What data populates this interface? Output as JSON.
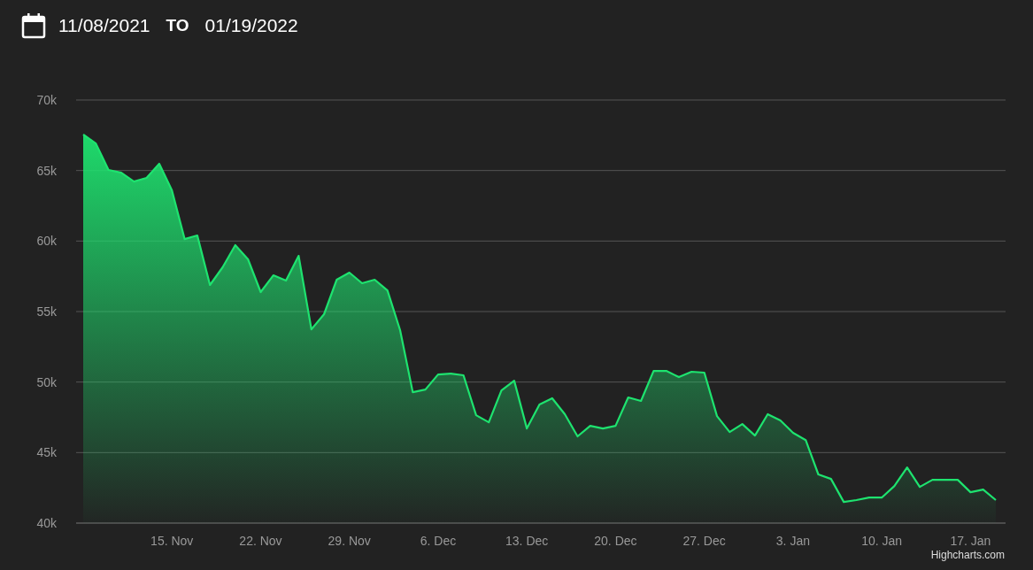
{
  "date_range": {
    "start": "11/08/2021",
    "separator": "TO",
    "end": "01/19/2022"
  },
  "chart_data": {
    "type": "area",
    "grid": true,
    "ylim": [
      40000,
      70000
    ],
    "categories": [
      null,
      null,
      null,
      null,
      null,
      null,
      null,
      "15. Nov",
      null,
      null,
      null,
      null,
      null,
      null,
      "22. Nov",
      null,
      null,
      null,
      null,
      null,
      null,
      "29. Nov",
      null,
      null,
      null,
      null,
      null,
      null,
      "6. Dec",
      null,
      null,
      null,
      null,
      null,
      null,
      "13. Dec",
      null,
      null,
      null,
      null,
      null,
      null,
      "20. Dec",
      null,
      null,
      null,
      null,
      null,
      null,
      "27. Dec",
      null,
      null,
      null,
      null,
      null,
      null,
      "3. Jan",
      null,
      null,
      null,
      null,
      null,
      null,
      "10. Jan",
      null,
      null,
      null,
      null,
      null,
      null,
      "17. Jan",
      null,
      null
    ],
    "yticks": [
      {
        "value": 40000,
        "label": "40k"
      },
      {
        "value": 45000,
        "label": "45k"
      },
      {
        "value": 50000,
        "label": "50k"
      },
      {
        "value": 55000,
        "label": "55k"
      },
      {
        "value": 60000,
        "label": "60k"
      },
      {
        "value": 65000,
        "label": "65k"
      },
      {
        "value": 70000,
        "label": "70k"
      }
    ],
    "series": [
      {
        "color": "#1ee36f",
        "values": [
          67550,
          66920,
          65040,
          64850,
          64220,
          64480,
          65480,
          63600,
          60140,
          60400,
          56880,
          58140,
          59710,
          58700,
          56380,
          57570,
          57190,
          58950,
          53740,
          54810,
          57260,
          57760,
          57010,
          57260,
          56500,
          53680,
          49280,
          49470,
          50540,
          50600,
          50480,
          47650,
          47150,
          49410,
          50100,
          46710,
          48410,
          48850,
          47720,
          46150,
          46900,
          46710,
          46900,
          48910,
          48660,
          50790,
          50790,
          50350,
          50730,
          50670,
          47590,
          46460,
          47020,
          46210,
          47720,
          47280,
          46400,
          45890,
          43450,
          43130,
          41500,
          41630,
          41810,
          41810,
          42630,
          43950,
          42570,
          43070,
          43070,
          43070,
          42190,
          42380,
          41630
        ]
      }
    ]
  },
  "credit": "Highcharts.com"
}
